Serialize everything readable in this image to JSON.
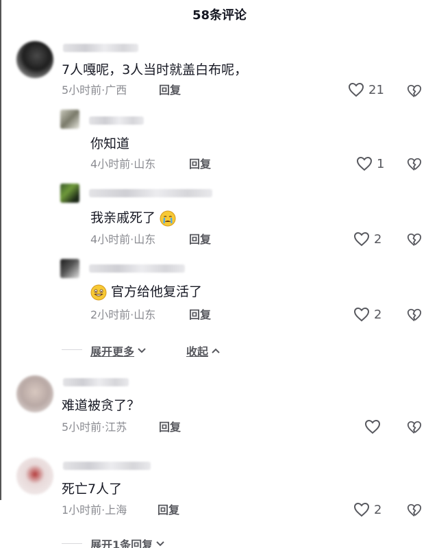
{
  "header": {
    "title": "58条评论"
  },
  "comments": [
    {
      "text": "7人嘎呢，3人当时就盖白布呢，",
      "time": "5小时前·广西",
      "reply": "回复",
      "likes": "21"
    },
    {
      "text": "你知道",
      "time": "4小时前·山东",
      "reply": "回复",
      "likes": "1"
    },
    {
      "text": "我亲戚死了",
      "time": "4小时前·山东",
      "reply": "回复",
      "likes": "2"
    },
    {
      "text": "官方给他复活了",
      "time": "2小时前·山东",
      "reply": "回复",
      "likes": "2"
    },
    {
      "text": "难道被贪了？",
      "time": "5小时前·江苏",
      "reply": "回复",
      "likes": ""
    },
    {
      "text": "死亡7人了",
      "time": "1小时前·上海",
      "reply": "回复",
      "likes": "2"
    }
  ],
  "thread": {
    "expand_more": "展开更多",
    "collapse": "收起"
  },
  "footer": {
    "expand_one": "展开1条回复"
  },
  "icons": {
    "like": "heart-outline-icon",
    "dislike": "broken-heart-icon",
    "emoji_cry": "crying-face-emoji",
    "emoji_smile": "grinning-face-emoji"
  },
  "colors": {
    "text": "#161823",
    "meta": "#8a8b91",
    "icon": "#57585e"
  }
}
